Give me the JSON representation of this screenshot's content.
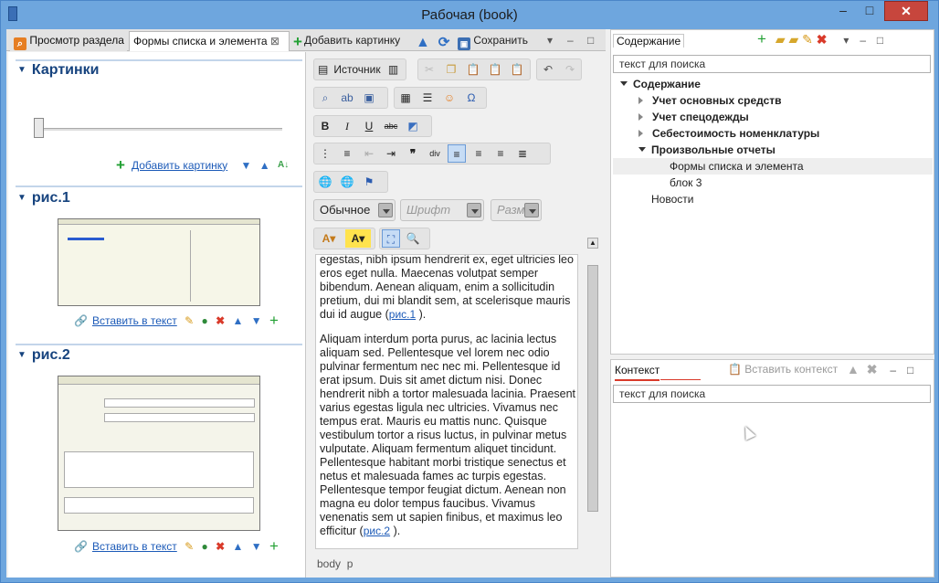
{
  "window": {
    "title": "Рабочая (book)",
    "minimize": "–",
    "maximize": "□",
    "close": "✕"
  },
  "tabs": {
    "preview": "Просмотр раздела",
    "forms": "Формы списка и элемента",
    "add_picture": "Добавить картинку",
    "save": "Сохранить"
  },
  "pictures": {
    "header": "Картинки",
    "add_picture": "Добавить картинку",
    "items": [
      {
        "title": "рис.1",
        "insert": "Вставить в текст"
      },
      {
        "title": "рис.2",
        "insert": "Вставить в текст"
      }
    ]
  },
  "editor": {
    "source": "Источник",
    "style": "Обычное",
    "font_placeholder": "Шрифт",
    "size_placeholder": "Разм",
    "para1": "egestas, nibh ipsum hendrerit ex, eget ultricies leo eros eget nulla. Maecenas volutpat semper bibendum. Aenean aliquam, enim a sollicitudin pretium, dui mi blandit sem, at scelerisque mauris dui id augue (",
    "link1": "рис.1",
    "para1_end": " ).",
    "para2": "Aliquam interdum porta purus, ac lacinia lectus aliquam sed. Pellentesque vel lorem nec odio pulvinar fermentum nec nec mi. Pellentesque id erat ipsum. Duis sit amet dictum nisi. Donec hendrerit nibh a tortor malesuada lacinia. Praesent varius egestas ligula nec ultricies. Vivamus nec tempus erat. Mauris eu mattis nunc. Quisque vestibulum tortor a risus luctus, in pulvinar metus vulputate. Aliquam fermentum aliquet tincidunt. Pellentesque habitant morbi tristique senectus et netus et malesuada fames ac turpis egestas. Pellentesque tempor feugiat dictum. Aenean non magna eu dolor tempus faucibus. Vivamus venenatis sem ut sapien finibus, et maximus leo efficitur (",
    "link2": "рис.2",
    "para2_end": " ).",
    "status_body": "body",
    "status_p": "p"
  },
  "contents": {
    "tab": "Содержание",
    "search_placeholder": "текст для поиска",
    "tree": {
      "root": "Содержание",
      "i1": "Учет основных средств",
      "i2": "Учет спецодежды",
      "i3": "Себестоимость номенклатуры",
      "i4": "Произвольные отчеты",
      "i4a": "Формы списка и элемента",
      "i4b": "блок 3",
      "i5": "Новости"
    }
  },
  "context": {
    "tab": "Контекст",
    "insert": "Вставить контекст",
    "search_placeholder": "текст для поиска"
  },
  "colors": {
    "accent": "#1d5bb8",
    "header": "#16437e",
    "close": "#c7463d"
  }
}
